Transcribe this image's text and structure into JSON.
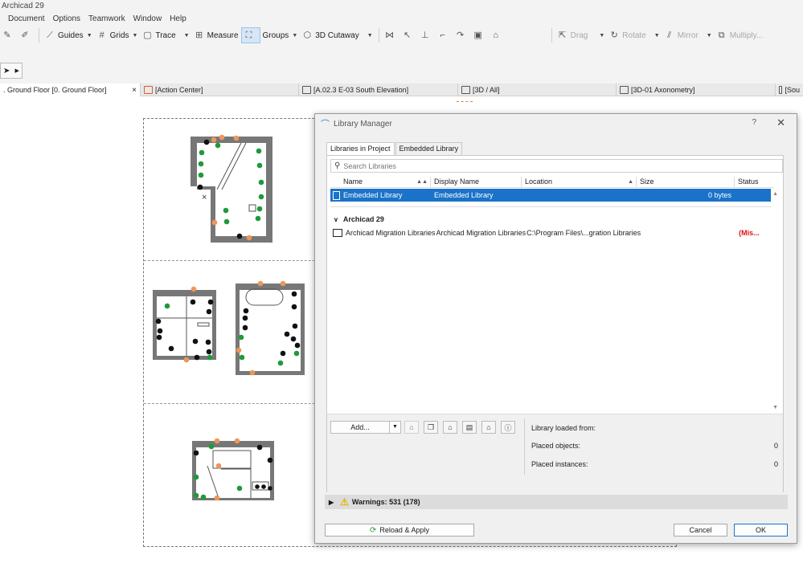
{
  "app": {
    "title": "Archicad 29"
  },
  "menu": [
    "Document",
    "Options",
    "Teamwork",
    "Window",
    "Help"
  ],
  "toolbar": {
    "guides": "Guides",
    "grids": "Grids",
    "trace": "Trace",
    "measure": "Measure",
    "groups": "Groups",
    "cutaway": "3D Cutaway",
    "drag": "Drag",
    "rotate": "Rotate",
    "mirror": "Mirror",
    "multiply": "Multiply..."
  },
  "tabs": [
    {
      "label": ". Ground Floor [0. Ground Floor]",
      "active": true
    },
    {
      "label": "[Action Center]"
    },
    {
      "label": "[A.02.3 E-03 South Elevation]"
    },
    {
      "label": "[3D / All]"
    },
    {
      "label": "[3D-01 Axonometry]"
    },
    {
      "label": "[Sou"
    }
  ],
  "tab_close": "×",
  "dialog": {
    "title": "Library Manager",
    "help": "?",
    "close": "✕",
    "tabs": [
      "Libraries in Project",
      "Embedded Library"
    ],
    "search_placeholder": "Search Libraries",
    "columns": [
      "Name",
      "Display Name",
      "Location",
      "Size",
      "Status"
    ],
    "selected_row": {
      "name": "Embedded Library",
      "display": "Embedded Library",
      "location": "",
      "size": "0 bytes",
      "status": ""
    },
    "group": "Archicad 29",
    "rows": [
      {
        "name": "Archicad Migration Libraries",
        "display": "Archicad Migration Libraries",
        "location": "C:\\Program Files\\...gration Libraries",
        "size": "",
        "status": "(Mis..."
      }
    ],
    "add_label": "Add...",
    "info": [
      {
        "label": "Library loaded from:",
        "value": ""
      },
      {
        "label": "Placed objects:",
        "value": "0"
      },
      {
        "label": "Placed instances:",
        "value": "0"
      }
    ],
    "warnings": "Warnings: 531 (178)",
    "reload": "Reload & Apply",
    "cancel": "Cancel",
    "ok": "OK"
  },
  "colors": {
    "accent": "#1a73c8",
    "missing": "#dd1111",
    "green_dot": "#1e9a3a",
    "orange_dot": "#f0955a"
  }
}
